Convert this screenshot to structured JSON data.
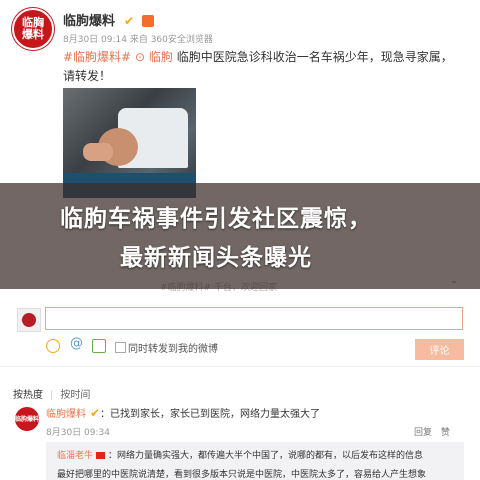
{
  "post": {
    "avatar_text": "临胸爆料",
    "author": "临朐爆料",
    "verified_icon": "v-badge-icon",
    "meta": "8月30日 09:14 来自 360安全浏览器",
    "hashtag": "#临朐爆料#",
    "location": "临朐",
    "body": "临朐中医院急诊科收治一名车祸少年，现急寻家属，请转发！",
    "image": "injured-boy-photo"
  },
  "banner": {
    "line1": "临朐车祸事件引发社区震惊，",
    "line2": "最新新闻头条曝光"
  },
  "faded_hint": "#临朐爆料# 千台，欢迎回家",
  "composer": {
    "input_value": "",
    "also_forward_label": "同时转发到我的微博",
    "submit_label": "评论"
  },
  "sort": {
    "hot_label": "按热度",
    "time_label": "按时间"
  },
  "comment": {
    "avatar_text": "临朐爆料",
    "author": "临朐爆料",
    "text": "：已找到家长，家长已到医院，网络力量太强大了",
    "meta": "8月30日 09:34",
    "actions": [
      "回复",
      "赞"
    ]
  },
  "reply": {
    "author": "临淄老牛",
    "line1": "：网络力量确实强大，都传遍大半个中国了，说哪的都有，以后发布这样的信息",
    "line2": "最好把哪里的中医院说清楚，看到很多版本只说是中医院，中医院太多了，容易给人产生想象"
  },
  "colors": {
    "brand_red": "#c8161d",
    "link_orange": "#eb7350",
    "submit_disabled": "#f7bba1"
  }
}
